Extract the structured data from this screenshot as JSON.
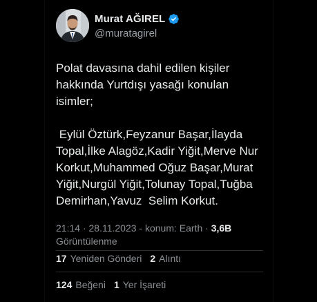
{
  "author": {
    "display_name": "Murat AĞIREL",
    "handle": "@muratagirel"
  },
  "tweet": {
    "text": "Polat davasına dahil edilen kişiler\nhakkında Yurtdışı yasağı konulan\nisimler;\n\n Eylül Öztürk,Feyzanur Başar,İlayda\nTopal,İlke Alagöz,Kadir Yiğit,Merve Nur\nKorkut,Muhammed Oğuz Başar,Murat\nYiğit,Nurgül Yiğit,Tolunay Topal,Tuğba\nDemirhan,Yavuz  Selim Korkut."
  },
  "meta": {
    "time": "21:14",
    "separator1": "·",
    "date": "28.11.2023",
    "separator2": "-",
    "location": "konum: Earth",
    "separator3": "·",
    "views_count": "3,6B",
    "views_label": "Görüntülenme"
  },
  "stats": {
    "retweets_count": "17",
    "retweets_label": "Yeniden Gönderi",
    "quotes_count": "2",
    "quotes_label": "Alıntı",
    "likes_count": "124",
    "likes_label": "Beğeni",
    "bookmarks_count": "1",
    "bookmarks_label": "Yer İşareti"
  },
  "colors": {
    "background": "#000000",
    "text": "#e7e9ea",
    "secondary_text": "#8b9095",
    "verified_badge": "#1d9bf0",
    "divider": "#2a2d31"
  },
  "icons": {
    "verified": "verified-badge-icon"
  }
}
